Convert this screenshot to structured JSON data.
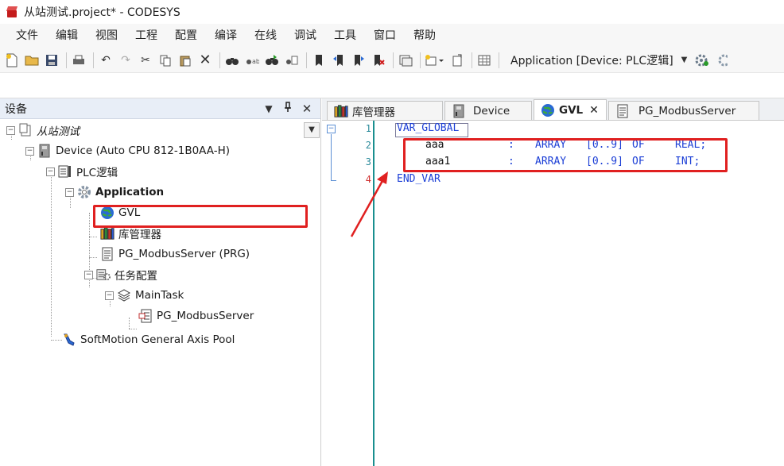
{
  "window": {
    "title": "从站测试.project* - CODESYS"
  },
  "menu": {
    "items": [
      "文件",
      "编辑",
      "视图",
      "工程",
      "配置",
      "编译",
      "在线",
      "调试",
      "工具",
      "窗口",
      "帮助"
    ]
  },
  "toolbar": {
    "application_select": "Application [Device: PLC逻辑]"
  },
  "devices_panel": {
    "title": "设备",
    "tree": [
      {
        "label": "从站测试",
        "icon": "project-icon"
      },
      {
        "label": "Device (Auto CPU 812-1B0AA-H)",
        "icon": "device-icon"
      },
      {
        "label": "PLC逻辑",
        "icon": "plc-logic-icon"
      },
      {
        "label": "Application",
        "icon": "application-gear-icon"
      },
      {
        "label": "GVL",
        "icon": "globe-icon"
      },
      {
        "label": "库管理器",
        "icon": "library-icon"
      },
      {
        "label": "PG_ModbusServer (PRG)",
        "icon": "program-icon"
      },
      {
        "label": "任务配置",
        "icon": "task-config-icon"
      },
      {
        "label": "MainTask",
        "icon": "task-icon"
      },
      {
        "label": "PG_ModbusServer",
        "icon": "program-call-icon"
      },
      {
        "label": "SoftMotion General Axis Pool",
        "icon": "axis-pool-icon"
      }
    ]
  },
  "editor": {
    "tabs": [
      {
        "label": "库管理器",
        "icon": "library-icon",
        "active": false
      },
      {
        "label": "Device",
        "icon": "device-icon",
        "active": false
      },
      {
        "label": "GVL",
        "icon": "globe-icon",
        "active": true
      },
      {
        "label": "PG_ModbusServer",
        "icon": "program-icon",
        "active": false
      }
    ],
    "line_numbers": [
      "1",
      "2",
      "3",
      "4"
    ],
    "code": {
      "line1": "VAR_GLOBAL",
      "line2": {
        "name": "aaa",
        "colon": ":",
        "type_kw": "ARRAY",
        "range": "[0..9]",
        "of": "OF",
        "base": "REAL",
        "semicolon": ";"
      },
      "line3": {
        "name": "aaa1",
        "colon": ":",
        "type_kw": "ARRAY",
        "range": "[0..9]",
        "of": "OF",
        "base": "INT",
        "semicolon": ";"
      },
      "line4": "END_VAR"
    }
  },
  "colors": {
    "highlight_red": "#e02020",
    "keyword_blue": "#1c3fd6",
    "gutter_teal": "#1a8f8f"
  }
}
